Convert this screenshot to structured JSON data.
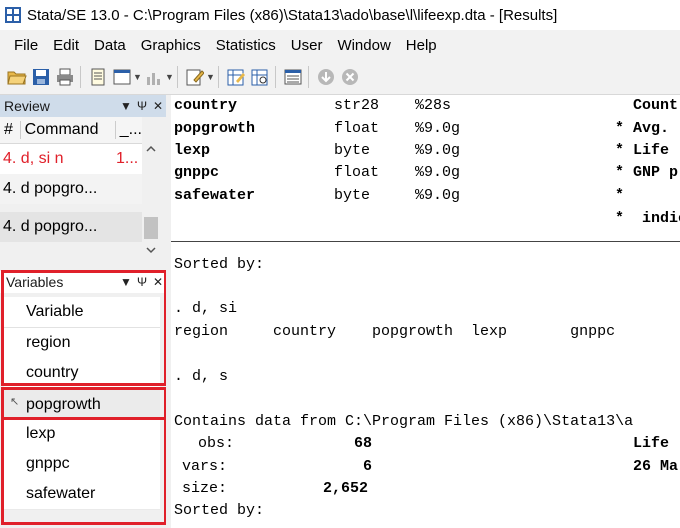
{
  "window": {
    "title": "Stata/SE 13.0 - C:\\Program Files (x86)\\Stata13\\ado\\base\\l\\lifeexp.dta - [Results]"
  },
  "menu": {
    "items": [
      "File",
      "Edit",
      "Data",
      "Graphics",
      "Statistics",
      "User",
      "Window",
      "Help"
    ]
  },
  "toolbar": {
    "icons": [
      "open-icon",
      "save-icon",
      "print-icon",
      "log-icon",
      "viewer-icon",
      "graph-icon",
      "do-file-editor-icon",
      "data-editor-icon",
      "data-browser-icon",
      "variables-manager-icon",
      "more-icon",
      "break-icon"
    ]
  },
  "review": {
    "title": "Review",
    "pin_symbol": "Ψ",
    "close_symbol": "✕",
    "filter_symbol": "▼",
    "col_hash": "#",
    "col_command": "Command",
    "col_rc": "_...",
    "rows": [
      {
        "cmd": "4. d, si n",
        "rc": "1...",
        "error": true
      },
      {
        "cmd": "4. d popgro...",
        "rc": "",
        "error": false
      },
      {
        "cmd": "4. d popgro...",
        "rc": "",
        "error": false
      }
    ]
  },
  "variables": {
    "title": "Variables",
    "col_variable": "Variable",
    "items": [
      "region",
      "country",
      "popgrowth",
      "lexp",
      "gnppc",
      "safewater"
    ]
  },
  "results": {
    "describe_rows": [
      {
        "name": "country",
        "type": "str28",
        "fmt": "%28s",
        "flag": " ",
        "label": "Count"
      },
      {
        "name": "popgrowth",
        "type": "float",
        "fmt": "%9.0g",
        "flag": "*",
        "label": "Avg."
      },
      {
        "name": "lexp",
        "type": "byte",
        "fmt": "%9.0g",
        "flag": "*",
        "label": "Life"
      },
      {
        "name": "gnppc",
        "type": "float",
        "fmt": "%9.0g",
        "flag": "*",
        "label": "GNP p"
      },
      {
        "name": "safewater",
        "type": "byte",
        "fmt": "%9.0g",
        "flag": "*",
        "label": ""
      }
    ],
    "indic_line": "*  indic",
    "sorted_by_1": "Sorted by:",
    "cmd_d_si": ". d, si",
    "si_vars": "region     country    popgrowth  lexp       gnppc",
    "cmd_d_s": ". d, s",
    "contains": "Contains data from C:\\Program Files (x86)\\Stata13\\a",
    "obs_label": "obs:",
    "obs_value": "68",
    "obs_right": "Life",
    "vars_label": "vars:",
    "vars_value": "6",
    "vars_right": "26 Ma",
    "size_label": "size:",
    "size_value": "2,652",
    "sorted_by_2": "Sorted by:"
  },
  "colors": {
    "highlight": "#e0202a",
    "error_text": "#e0202a",
    "review_header_bg": "#cfdcea"
  }
}
